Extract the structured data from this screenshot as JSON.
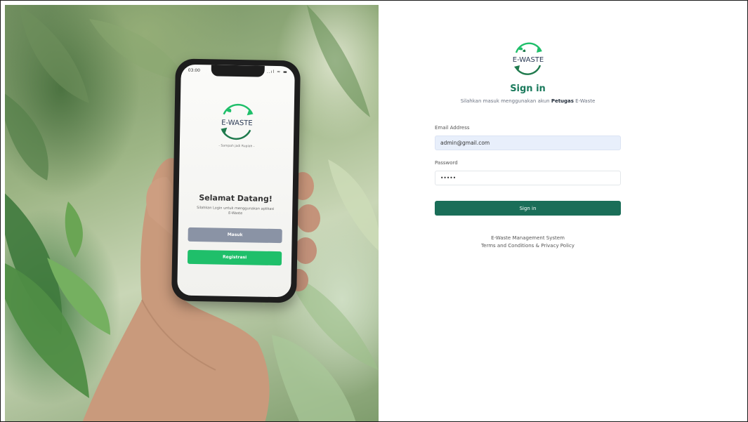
{
  "phone": {
    "time": "03:00",
    "status_icons": "..ıl ≈ ▬",
    "logo_text": "E-WASTE",
    "tagline": "- Sampah jadi Rupiah -",
    "welcome": "Selamat Datang!",
    "subtitle": "Silahkan Login untuk menggunakan aplikasi E-Waste",
    "masuk_label": "Masuk",
    "registrasi_label": "Registrasi"
  },
  "login": {
    "logo_text": "E-WASTE",
    "title": "Sign in",
    "subtitle_pre": "Silahkan masuk menggunakan akun ",
    "subtitle_bold": "Petugas",
    "subtitle_post": " E-Waste",
    "email_label": "Email Address",
    "email_value": "admin@gmail.com",
    "password_label": "Password",
    "password_value": "•••••",
    "signin_label": "Sign in",
    "footer_line1": "E-Waste Management System",
    "footer_line2": "Terms and Conditions & Privacy Policy"
  },
  "colors": {
    "brand_green": "#1a7a5c",
    "button_green": "#1a6e58",
    "logo_bright_green": "#1fbf6a",
    "email_bg": "#e8effb"
  },
  "icons": {
    "logo": "recycle-arrows-icon"
  }
}
